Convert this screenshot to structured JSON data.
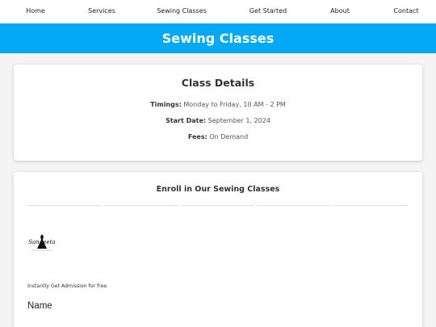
{
  "nav": {
    "items": [
      "Home",
      "Services",
      "Sewing Classes",
      "Get Started",
      "About",
      "Contact"
    ]
  },
  "banner": {
    "title": "Sewing Classes"
  },
  "class_details": {
    "title": "Class Details",
    "timings_label": "Timings:",
    "timings_value": "Monday to Friday, 10 AM - 2 PM",
    "start_label": "Start Date:",
    "start_value": "September 1, 2024",
    "fees_label": "Fees:",
    "fees_value": "On Demand"
  },
  "enroll": {
    "title": "Enroll in Our Sewing Classes",
    "logo_text": "Sangeeta",
    "admission_text": "Instantly Get Admission for free",
    "name_label": "Name"
  },
  "colors": {
    "accent": "#03a9f4",
    "background": "#f4f4f4",
    "card": "#ffffff"
  }
}
